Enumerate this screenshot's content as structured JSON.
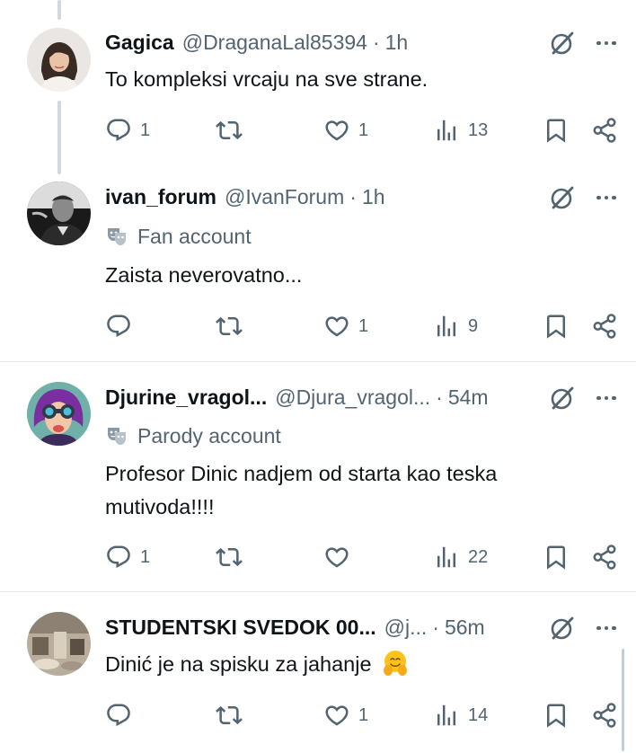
{
  "tweets": [
    {
      "name": "Gagica",
      "handle": "@DraganaLal85394",
      "separator": "·",
      "time": "1h",
      "label": "",
      "text": "To kompleksi vrcaju na sve strane.",
      "replies": "1",
      "reposts": "",
      "likes": "1",
      "views": "13"
    },
    {
      "name": "ivan_forum",
      "handle": "@IvanForum",
      "separator": "·",
      "time": "1h",
      "label": "Fan account",
      "text": "Zaista neverovatno...",
      "replies": "",
      "reposts": "",
      "likes": "1",
      "views": "9"
    },
    {
      "name": "Djurine_vragol...",
      "handle": "@Djura_vragol...",
      "separator": "·",
      "time": "54m",
      "label": "Parody account",
      "text": "Profesor Dinic nadjem od starta kao teska mutivoda!!!!",
      "replies": "1",
      "reposts": "",
      "likes": "",
      "views": "22"
    },
    {
      "name": "STUDENTSKI SVEDOK 00...",
      "handle": "@j...",
      "separator": "·",
      "time": "56m",
      "label": "",
      "text": "Dinić je na spisku za jahanje",
      "emoji": "hugging-face-emoji",
      "replies": "",
      "reposts": "",
      "likes": "1",
      "views": "14"
    }
  ],
  "icons": {
    "reply": "reply-icon",
    "repost": "repost-icon",
    "like": "like-icon",
    "views": "views-icon",
    "bookmark": "bookmark-icon",
    "share": "share-icon",
    "grok": "grok-icon",
    "more": "more-icon",
    "label": "theater-mask-icon"
  },
  "colors": {
    "text": "#0f1419",
    "secondary": "#536471",
    "divider": "#e7ebee",
    "thread_line": "#cfd9de"
  }
}
